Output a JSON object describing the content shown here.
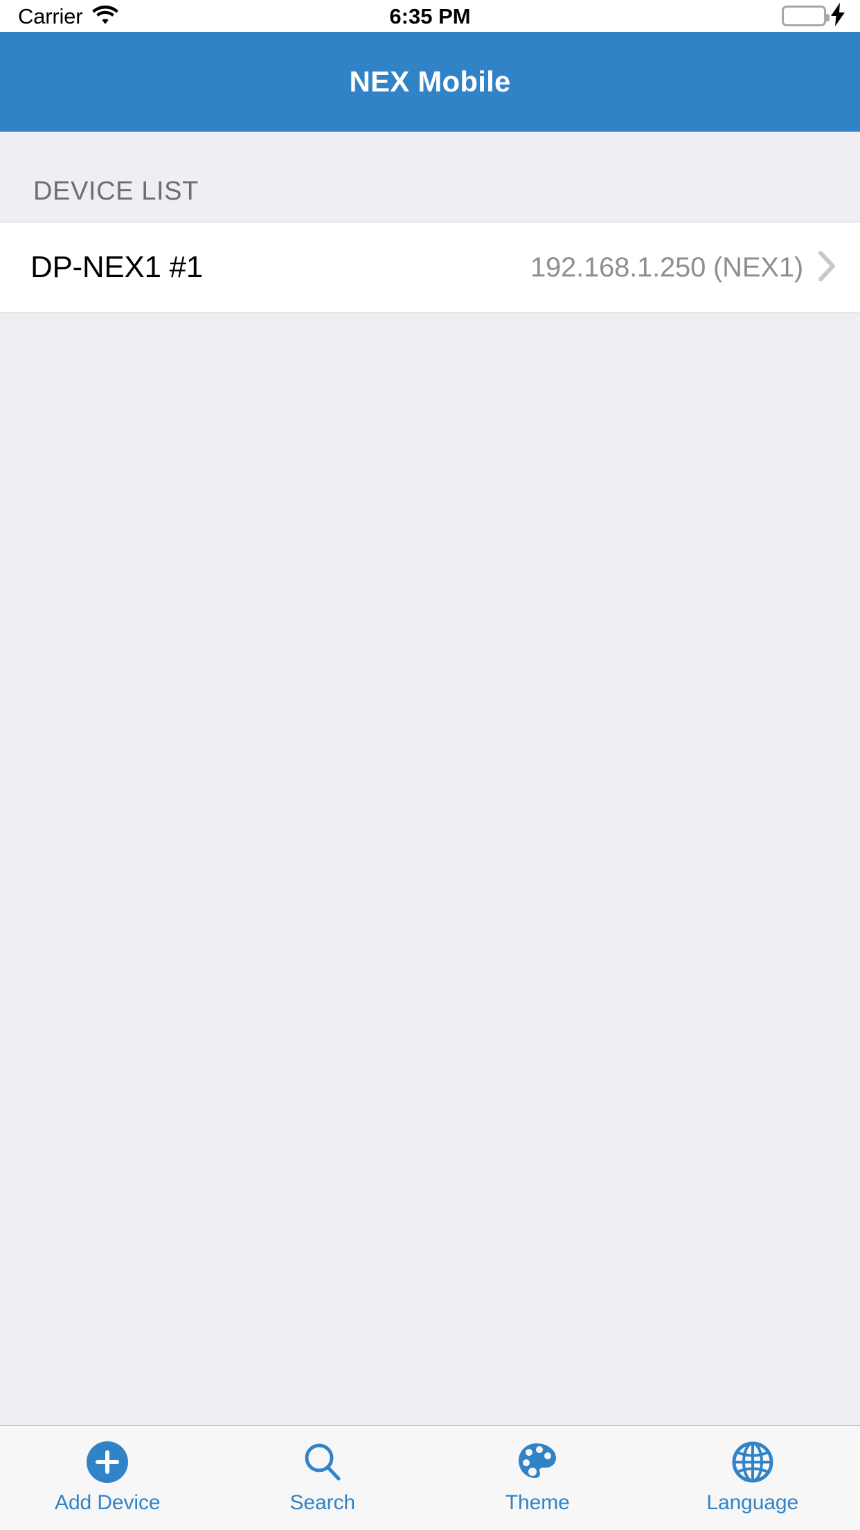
{
  "status_bar": {
    "carrier": "Carrier",
    "time": "6:35 PM",
    "wifi_icon": "wifi-icon",
    "battery_icon": "battery-icon",
    "charging_icon": "lightning-bolt-icon",
    "battery_color": "#4CD964"
  },
  "nav_bar": {
    "title": "NEX Mobile",
    "background_color": "#3183C8",
    "title_color": "#FFFFFF"
  },
  "main": {
    "section_header": "DEVICE LIST",
    "devices": [
      {
        "name": "DP-NEX1 #1",
        "detail": "192.168.1.250 (NEX1)",
        "accessory_icon": "chevron-right-icon"
      }
    ]
  },
  "tab_bar": {
    "accent_color": "#3183C8",
    "background_color": "#F7F7F7",
    "items": [
      {
        "label": "Add Device",
        "icon": "plus-circle-icon"
      },
      {
        "label": "Search",
        "icon": "magnifier-icon"
      },
      {
        "label": "Theme",
        "icon": "palette-icon"
      },
      {
        "label": "Language",
        "icon": "globe-icon"
      }
    ]
  }
}
